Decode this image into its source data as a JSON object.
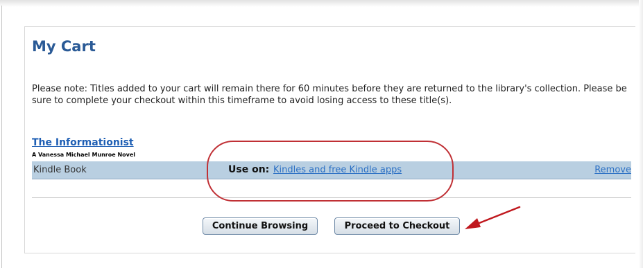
{
  "cart": {
    "title": "My Cart",
    "note": "Please note: Titles added to your cart will remain there for 60 minutes before they are returned to the library's collection. Please be sure to complete your checkout within this timeframe to avoid losing access to these title(s).",
    "items": [
      {
        "title": "The Informationist",
        "subtitle": "A Vanessa Michael Munroe Novel",
        "format": "Kindle Book",
        "use_on_label": "Use on:",
        "device_link": "Kindles and free Kindle apps",
        "remove_label": "Remove"
      }
    ],
    "buttons": {
      "continue_label": "Continue Browsing",
      "checkout_label": "Proceed to Checkout"
    }
  },
  "annotations": {
    "ellipse_color": "#c03035",
    "arrow_color": "#c0181e"
  },
  "colors": {
    "title": "#2a5a96",
    "link": "#2a6fc4",
    "row_background": "#b9cfe1"
  }
}
